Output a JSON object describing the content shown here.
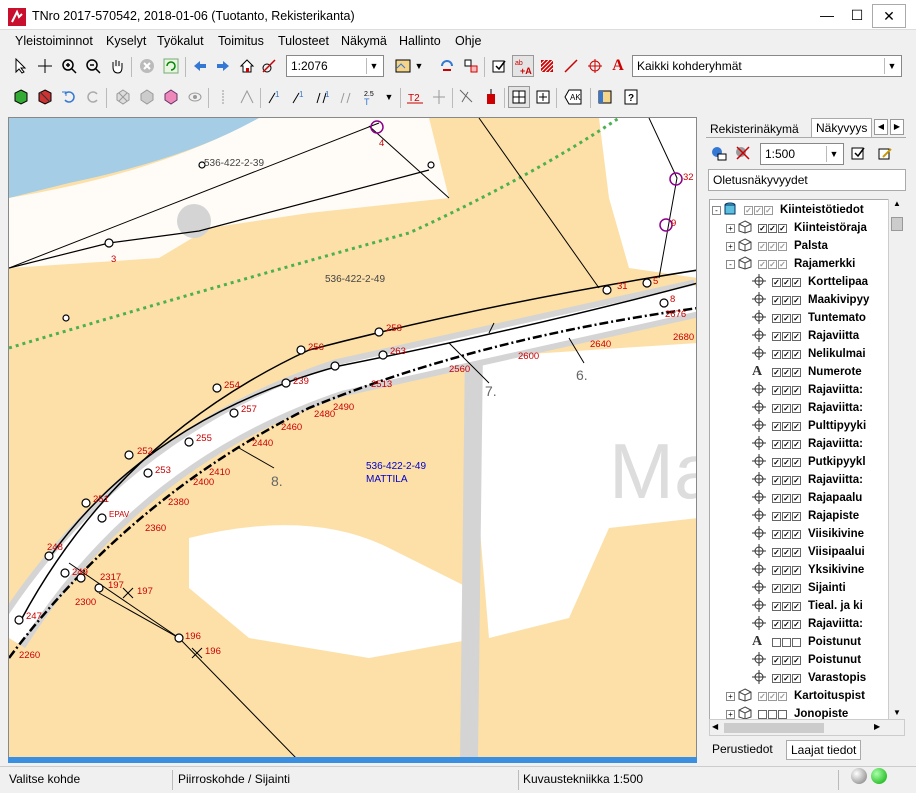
{
  "window": {
    "title": "TNro 2017-570542, 2018-01-06 (Tuotanto, Rekisterikanta)"
  },
  "menu": [
    "Yleistoiminnot",
    "Kyselyt",
    "Työkalut",
    "Toimitus",
    "Tulosteet",
    "Näkymä",
    "Hallinto",
    "Ohje"
  ],
  "toolbar": {
    "scale_value": "1:2076",
    "target_group": "Kaikki kohderyhmät"
  },
  "side_panel": {
    "tabs": [
      "Rekisterinäkymä",
      "Näkyvyys"
    ],
    "scale_value": "1:500",
    "view_name": "Oletusnäkyvyydet",
    "tree": [
      {
        "label": "Kiinteistötiedot",
        "checks": "grey",
        "icon": "db"
      },
      {
        "label": "Kiinteistöraja",
        "checks": "on",
        "icon": "cube"
      },
      {
        "label": "Palsta",
        "checks": "grey",
        "icon": "cube"
      },
      {
        "label": "Rajamerkki",
        "checks": "grey",
        "icon": "cube"
      },
      {
        "label": "Korttelipaa",
        "checks": "on",
        "icon": "cross"
      },
      {
        "label": "Maakivipyy",
        "checks": "on",
        "icon": "cross"
      },
      {
        "label": "Tuntemato",
        "checks": "on",
        "icon": "cross"
      },
      {
        "label": "Rajaviitta",
        "checks": "on",
        "icon": "cross"
      },
      {
        "label": "Nelikulmai",
        "checks": "on",
        "icon": "cross"
      },
      {
        "label": "Numerote",
        "checks": "on",
        "icon": "A"
      },
      {
        "label": "Rajaviitta: ",
        "checks": "on",
        "icon": "cross"
      },
      {
        "label": "Rajaviitta: ",
        "checks": "on",
        "icon": "cross"
      },
      {
        "label": "Pulttipyyki",
        "checks": "on",
        "icon": "cross"
      },
      {
        "label": "Rajaviitta: ",
        "checks": "on",
        "icon": "cross"
      },
      {
        "label": "Putkipyykl",
        "checks": "on",
        "icon": "cross"
      },
      {
        "label": "Rajaviitta: ",
        "checks": "on",
        "icon": "cross"
      },
      {
        "label": "Rajapaalu",
        "checks": "on",
        "icon": "cross"
      },
      {
        "label": "Rajapiste",
        "checks": "on",
        "icon": "cross"
      },
      {
        "label": "Viisikivine",
        "checks": "on",
        "icon": "cross"
      },
      {
        "label": "Viisipaalui",
        "checks": "on",
        "icon": "cross"
      },
      {
        "label": "Yksikivine",
        "checks": "on",
        "icon": "cross"
      },
      {
        "label": "Sijainti",
        "checks": "on",
        "icon": "cross"
      },
      {
        "label": "Tieal. ja ki",
        "checks": "on",
        "icon": "cross"
      },
      {
        "label": "Rajaviitta: ",
        "checks": "on",
        "icon": "cross"
      },
      {
        "label": "Poistunut",
        "checks": "off",
        "icon": "A"
      },
      {
        "label": "Poistunut",
        "checks": "on",
        "icon": "cross"
      },
      {
        "label": "Varastopis",
        "checks": "on",
        "icon": "cross"
      },
      {
        "label": "Kartoituspist",
        "checks": "grey",
        "icon": "cube"
      },
      {
        "label": "Jonopiste",
        "checks": "off",
        "icon": "cube"
      }
    ],
    "bottom_tabs": [
      "Perustiedot",
      "Laajat tiedot"
    ]
  },
  "map": {
    "parcels": [
      {
        "id": "p1",
        "text": "536-422-2-39"
      },
      {
        "id": "p2",
        "text": "536-422-2-49"
      },
      {
        "id": "p3",
        "text": "536-422-2-49"
      },
      {
        "id": "p4",
        "text": "MATTILA"
      }
    ],
    "big_text": "Ma",
    "numbers": [
      "4",
      "3",
      "32",
      "9",
      "31",
      "5",
      "8",
      "2676",
      "2680",
      "258",
      "256",
      "263",
      "2600",
      "2640",
      "2560",
      "7.",
      "6.",
      "254",
      "239",
      "2513",
      "257",
      "2490",
      "2480",
      "2460",
      "252",
      "255",
      "2440",
      "253",
      "2410",
      "2400",
      "8.",
      "251",
      "2380",
      "EPAV",
      "2360",
      "248",
      "249",
      "2317",
      "197",
      "197",
      "2300",
      "247",
      "196",
      "196",
      "2260"
    ]
  },
  "status": {
    "left": "Valitse kohde",
    "middle": "Piirroskohde / Sijainti",
    "right": "Kuvaustekniikka 1:500"
  }
}
